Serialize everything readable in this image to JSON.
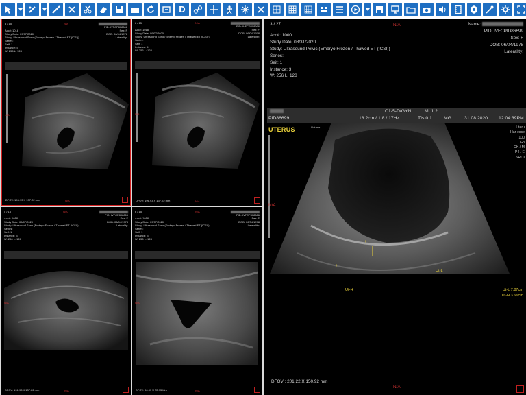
{
  "toolbar": {
    "icons": [
      "pointer-icon",
      "window-level-icon",
      "ruler-icon",
      "angle-icon",
      "eraser-icon",
      "scissors-icon",
      "cut-icon",
      "save-icon",
      "open-folder-icon",
      "refresh-icon",
      "export-icon",
      "d-text-icon",
      "link-icon",
      "crosshair-icon",
      "person-icon",
      "star-icon",
      "close-icon",
      "grid-1-icon",
      "grid-2-icon",
      "grid-3-icon",
      "list-icon",
      "play-icon",
      "disk-icon",
      "monitor-icon",
      "folder-icon",
      "camera-icon",
      "volume-icon",
      "film-icon",
      "settings-icon",
      "eyedropper-icon",
      "gear-icon",
      "fullscreen-icon"
    ],
    "d_glyph": "D"
  },
  "na_text": "N/A",
  "small_viewports": [
    {
      "series": "5 / 15",
      "acc": "Acc#: 1018",
      "study_date": "Study Date: 09/07/2020",
      "study": "Study: Ultrasound Sono (Embryo Frozen / Thawed ET (ICSI))",
      "series_label": "Series:",
      "seif": "Seif: 1",
      "instance": "Instance: 5",
      "wl": "W: 256 L: 128",
      "pid": "PID: IVFCP808666",
      "sex": "Sex: F",
      "dob": "DOB: 06/04/1978",
      "laterality": "Laterality:",
      "dfov": "DFOV: 196.93 X 137.22 mm"
    },
    {
      "series": "6 / 15",
      "acc": "Acc#: 1018",
      "study_date": "Study Date: 09/07/2020",
      "study": "Study: Ultrasound Sono (Embryo Frozen / Thawed ET (ICSI))",
      "series_label": "Series:",
      "seif": "Seif: 1",
      "instance": "Instance: 4",
      "wl": "W: 256 L: 128",
      "pid": "PID: IVFCP808666",
      "sex": "Sex: F",
      "dob": "DOB: 06/04/1978",
      "laterality": "Laterality:",
      "dfov": "DFOV: 196.93 X 137.22 mm"
    },
    {
      "series": "5 / 15",
      "acc": "Acc#: 1018",
      "study_date": "Study Date: 09/07/2020",
      "study": "Study: Ultrasound Sono (Embryo Frozen / Thawed ET (ICSI))",
      "series_label": "Series:",
      "seif": "Seif: 1",
      "instance": "Instance: 3",
      "wl": "W: 256 L: 128",
      "pid": "PID: IVFCP808666",
      "sex": "Sex: F",
      "dob": "DOB: 06/04/1978",
      "laterality": "Laterality:",
      "dfov": "DFOV: 196.93 X 137.22 mm"
    },
    {
      "series": "6 / 15",
      "acc": "Acc#: 1018",
      "study_date": "Study Date: 09/07/2020",
      "study": "Study: Ultrasound Sono (Embryo Frozen / Thawed ET (ICSI))",
      "series_label": "Series:",
      "seif": "Seif: 1",
      "instance": "Instance: 3",
      "wl": "W: 256 L: 128",
      "pid": "PID: IVFCP808666",
      "sex": "Sex: F",
      "dob": "DOB: 06/04/1978",
      "laterality": "Laterality:",
      "dfov": "DFOV: 96.93 X 72.93 Mm"
    }
  ],
  "main_viewport": {
    "series": "3 / 27",
    "acc": "Acc#: 1000",
    "study_date": "Study Date: 08/31/2020",
    "study": "Study: Ultrasound Pelvic (Embryo Frozen / Thawed ET (ICSI))",
    "series_label": "Series:",
    "seif": "Seif: 1",
    "instance": "Instance: 3",
    "wl": "W: 256 L: 128",
    "name_label": "Name:",
    "pid": "PID: IVFCPID86699",
    "sex": "Sex: F",
    "dob": "DOB: 06/04/1978",
    "laterality": "Laterality:",
    "header_probe": "C1-5-D/GYN",
    "header_mi": "MI 1.2",
    "header_pid": "PID86699",
    "header_depth": "18.2cm / 1.8 / 17Hz",
    "header_tis": "TIs 0.1",
    "header_mg": "MG",
    "header_date": "31.08.2020",
    "header_time": "12:04:39PM",
    "organ_label": "UTERUS",
    "volume_label": "Volume",
    "side_text": [
      "Uteru",
      "Har-esse",
      "100",
      "Gn",
      "CK / M",
      "P4 / E",
      "SRI II"
    ],
    "meas_l": "Ut-L  7.87cm",
    "meas_h": "Ut-H  3.66cm",
    "caliper_l": "Ut-L",
    "caliper_h": "Ut-H",
    "dfov": "DFOV : 201.22 X 150.92 mm"
  }
}
